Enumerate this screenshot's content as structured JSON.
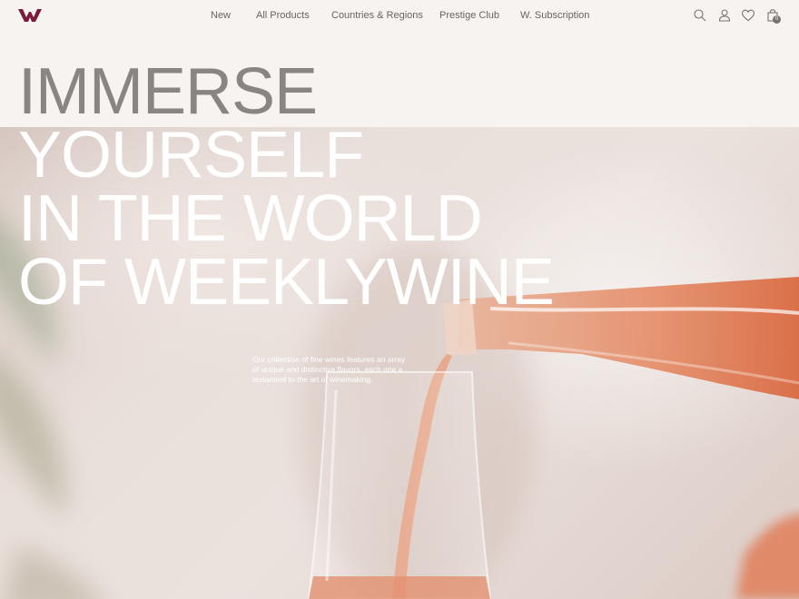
{
  "brand": {
    "logo_icon": "w-logo-icon",
    "accent_color": "#7a1a3c"
  },
  "nav": {
    "items": [
      {
        "label": "New"
      },
      {
        "label": "All Products"
      },
      {
        "label": "Countries & Regions"
      },
      {
        "label": "Prestige Club"
      },
      {
        "label": "W. Subscription"
      }
    ]
  },
  "header_icons": {
    "search": "search-icon",
    "account": "user-icon",
    "wishlist": "heart-icon",
    "cart": "shopping-bag-icon",
    "cart_count": "0"
  },
  "hero": {
    "headline_lines": [
      "IMMERSE",
      "YOURSELF",
      "IN THE WORLD",
      "OF WEEKLYWINE"
    ],
    "description": "Our collection of fine wines features an array of unique and distinctive flavors, each one a testament to the art of winemaking.",
    "image_subject": "rosé wine being poured from a bottle into a glass"
  }
}
